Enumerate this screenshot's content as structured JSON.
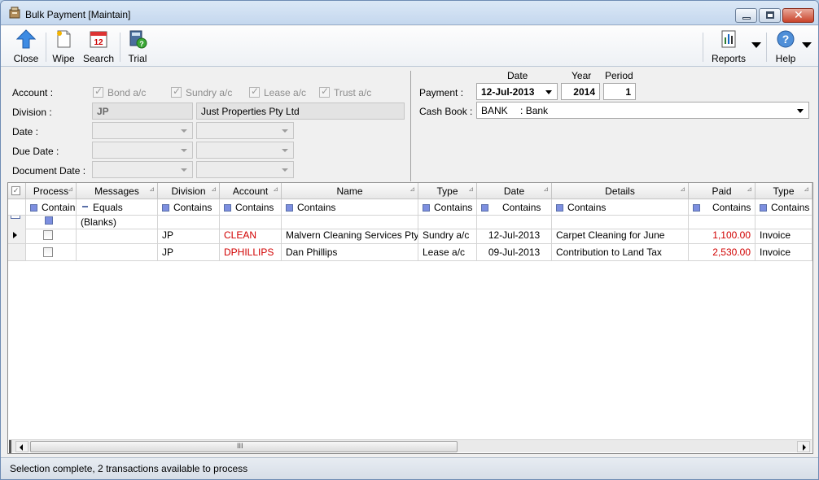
{
  "window": {
    "title": "Bulk Payment [Maintain]"
  },
  "toolbar": {
    "close": "Close",
    "wipe": "Wipe",
    "search": "Search",
    "trial": "Trial",
    "reports": "Reports",
    "help": "Help",
    "search_icon_text": "12"
  },
  "params": {
    "account_label": "Account :",
    "account_options": [
      "Bond a/c",
      "Sundry a/c",
      "Lease a/c",
      "Trust a/c"
    ],
    "division_label": "Division :",
    "division_code": "JP",
    "division_name": "Just Properties Pty Ltd",
    "date_label": "Date :",
    "due_date_label": "Due Date :",
    "document_date_label": "Document Date :",
    "payment_label": "Payment :",
    "date_header": "Date",
    "year_header": "Year",
    "period_header": "Period",
    "payment_date": "12-Jul-2013",
    "payment_year": "2014",
    "payment_period": "1",
    "cashbook_label": "Cash Book :",
    "cashbook_code": "BANK",
    "cashbook_name": ": Bank"
  },
  "grid": {
    "columns": [
      "Process",
      "Messages",
      "Division",
      "Account",
      "Name",
      "Type",
      "Date",
      "Details",
      "Paid",
      "Type"
    ],
    "filters": [
      "Contain",
      "Equals",
      "Contains",
      "Contains",
      "Contains",
      "Contains",
      "Contains",
      "Contains",
      "Contains",
      "Contains"
    ],
    "blanks_label": "(Blanks)",
    "rows": [
      {
        "division": "JP",
        "account": "CLEAN",
        "name": "Malvern Cleaning Services Pty",
        "type": "Sundry a/c",
        "date": "12-Jul-2013",
        "details": "Carpet Cleaning for June",
        "paid": "1,100.00",
        "type2": "Invoice"
      },
      {
        "division": "JP",
        "account": "DPHILLIPS",
        "name": "Dan Phillips",
        "type": "Lease a/c",
        "date": "09-Jul-2013",
        "details": "Contribution to Land Tax",
        "paid": "2,530.00",
        "type2": "Invoice"
      }
    ],
    "scroll_grip": "III"
  },
  "status": {
    "text": "Selection complete, 2 transactions available to process"
  },
  "colors": {
    "accent_red": "#d10000",
    "filter_blue": "#7d8fe0"
  }
}
